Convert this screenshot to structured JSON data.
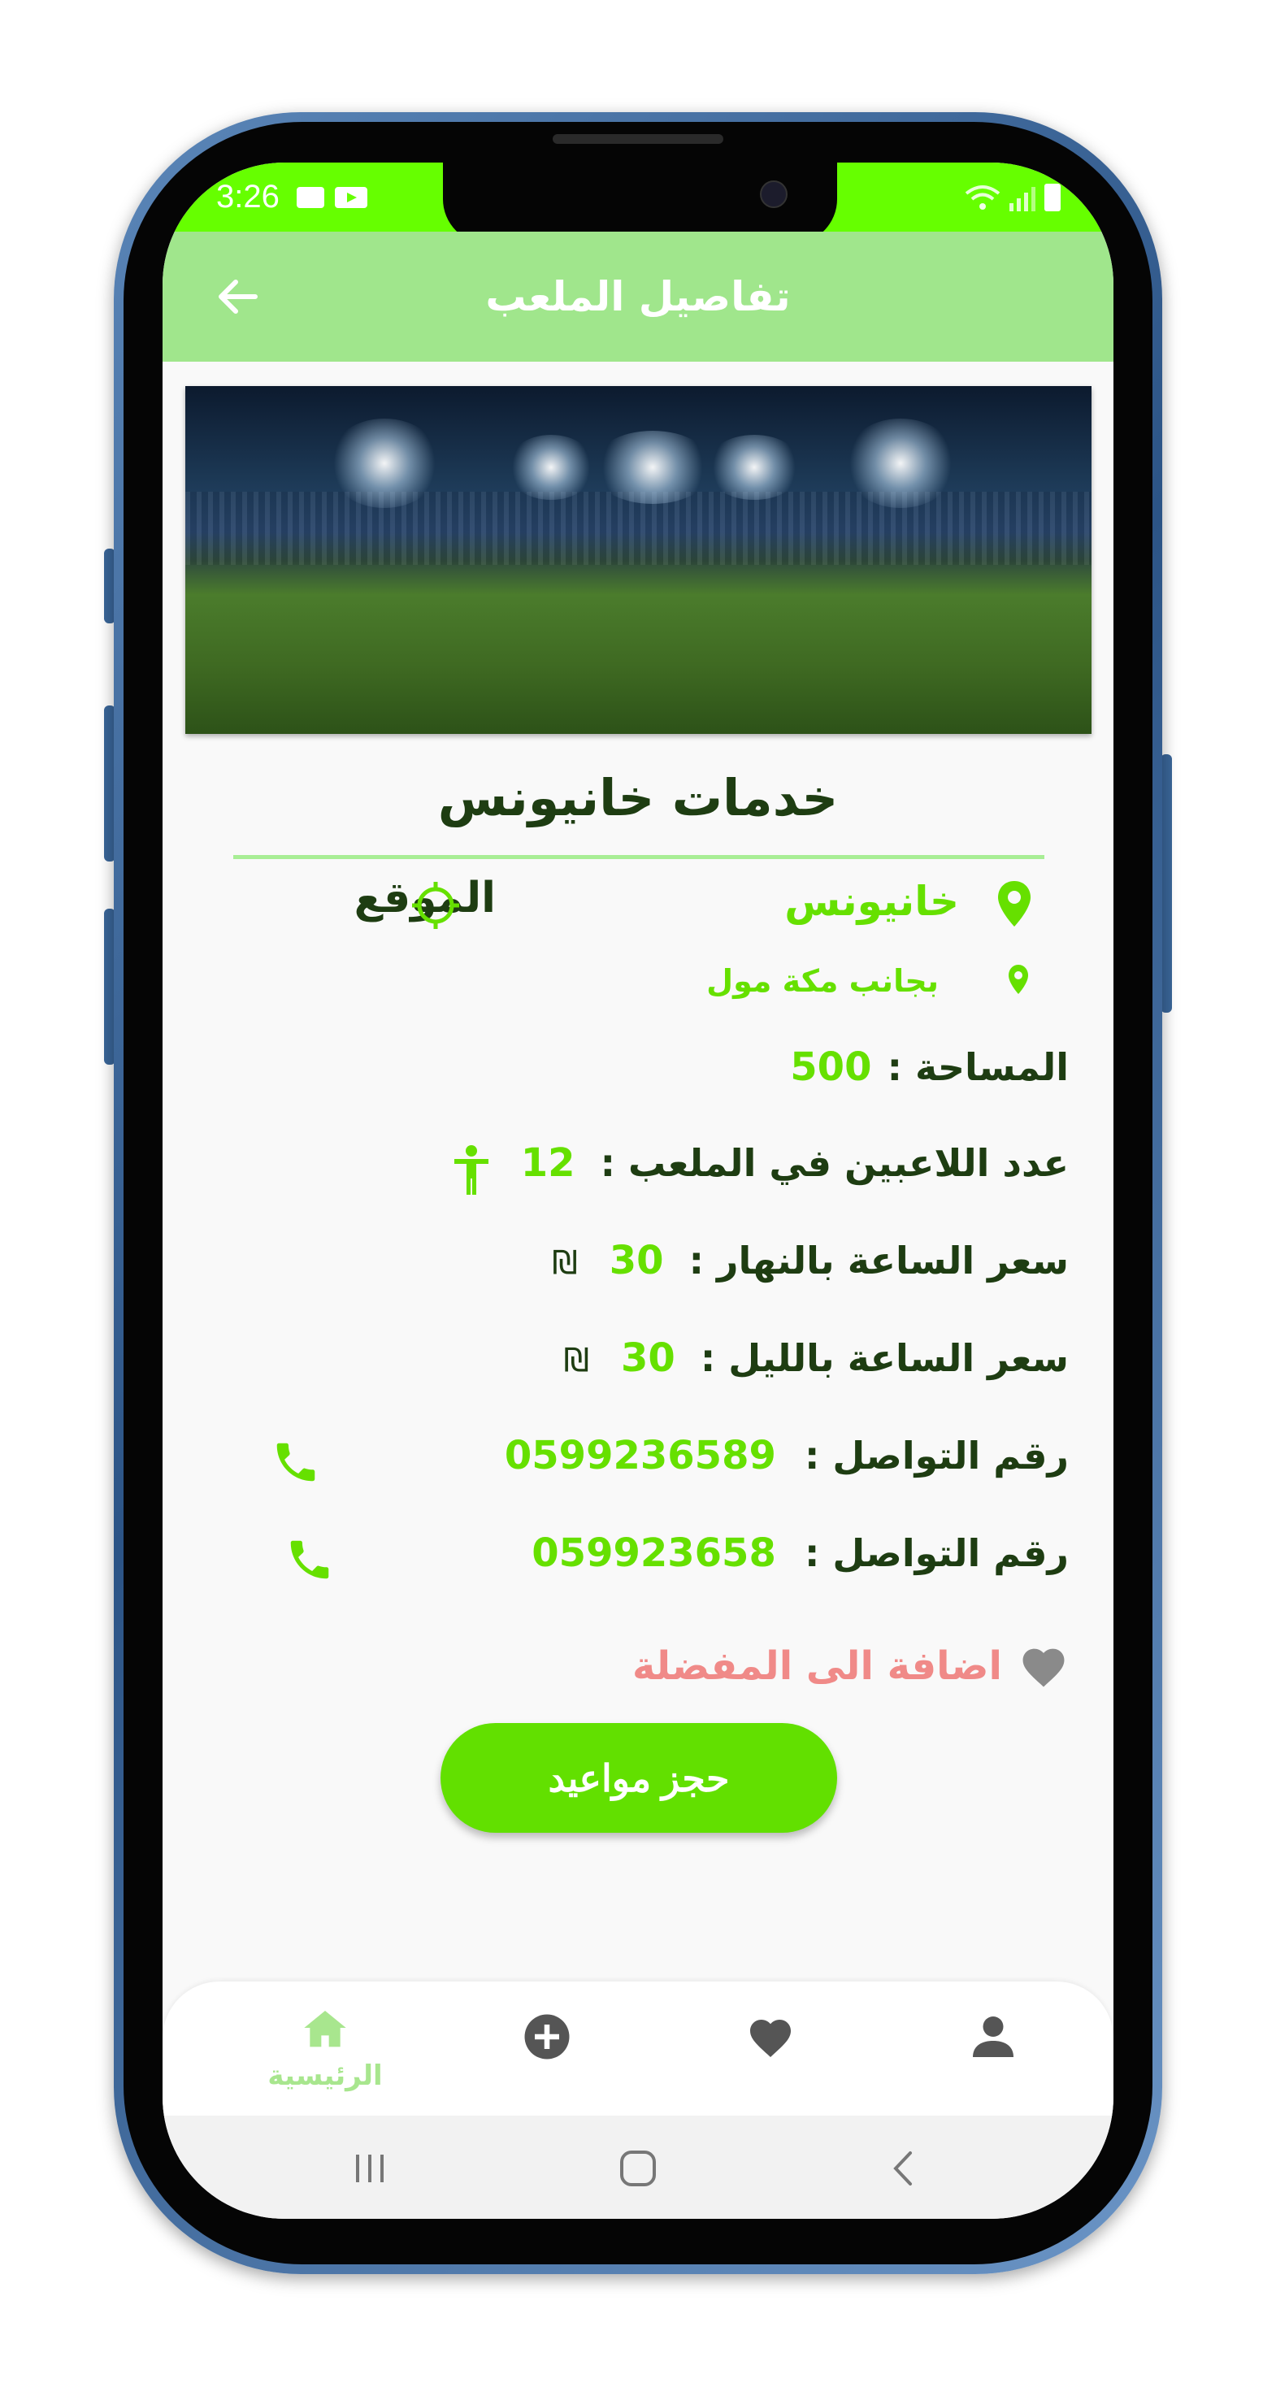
{
  "status_bar": {
    "time": "3:26",
    "icons": [
      "gallery-icon",
      "youtube-icon",
      "wifi-icon",
      "signal-icon",
      "battery-icon"
    ]
  },
  "app_bar": {
    "title": "تفاصيل الملعب",
    "back_icon": "arrow-left-icon",
    "color": "#a0e68c"
  },
  "venue": {
    "name": "خدمات خانيونس",
    "city": "خانيونس",
    "street": "بجانب مكة مول",
    "location_label": "الموقع",
    "details": {
      "area_label": "المساحة :",
      "area_value": "500",
      "players_label": "عدد اللاعبين في الملعب :",
      "players_value": "12",
      "day_price_label": "سعر الساعة بالنهار :",
      "day_price_value": "30",
      "night_price_label": "سعر الساعة بالليل :",
      "night_price_value": "30",
      "currency_symbol": "₪"
    },
    "contacts": [
      {
        "label": "رقم التواصل :",
        "value": "0599236589"
      },
      {
        "label": "رقم التواصل :",
        "value": "059923658"
      }
    ],
    "favorite_label": "اضافة الى المفضلة",
    "book_button_label": "حجز مواعيد"
  },
  "bottom_nav": {
    "items": [
      {
        "label": "الرئيسية",
        "icon": "home-icon",
        "active": true
      },
      {
        "label": "",
        "icon": "add-circle-icon",
        "active": false
      },
      {
        "label": "",
        "icon": "heart-icon",
        "active": false
      },
      {
        "label": "",
        "icon": "person-icon",
        "active": false
      }
    ]
  },
  "colors": {
    "status_bar": "#66ff00",
    "accent_green": "#66e000",
    "dark_text": "#1e3d12",
    "favorite_text": "#f08a88",
    "button": "#62e000"
  }
}
